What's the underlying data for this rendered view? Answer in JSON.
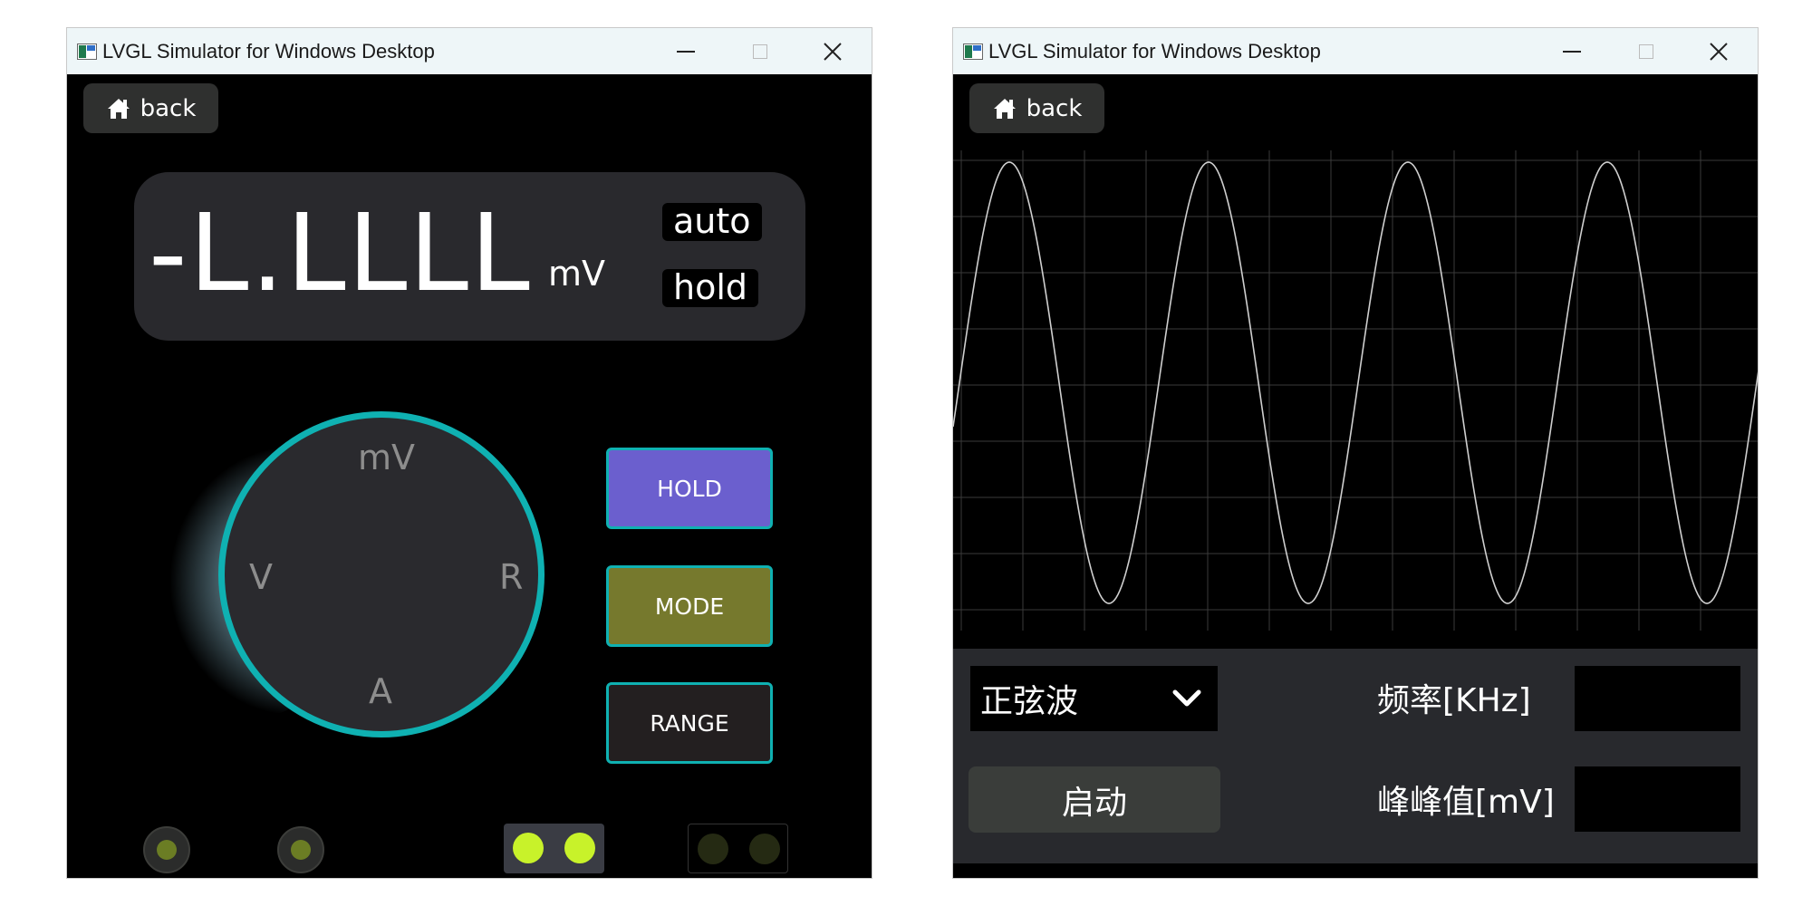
{
  "left_window": {
    "title": "LVGL Simulator for Windows Desktop",
    "back_label": "back",
    "display": {
      "reading": "-L.LLLL",
      "unit": "mV",
      "tag_auto": "auto",
      "tag_hold": "hold"
    },
    "dial": {
      "label_top": "mV",
      "label_left": "V",
      "label_right": "R",
      "label_bottom": "A"
    },
    "buttons": {
      "hold": "HOLD",
      "mode": "MODE",
      "range": "RANGE"
    },
    "colors": {
      "accent_teal": "#0fb1b2",
      "hold_button": "#6b5fce",
      "mode_button": "#76792d",
      "led_on": "#c8f22a"
    }
  },
  "right_window": {
    "title": "LVGL Simulator for Windows Desktop",
    "back_label": "back",
    "waveform": {
      "type": "sine",
      "cycles_visible": 4,
      "grid": true
    },
    "controls": {
      "wave_select_value": "正弦波",
      "start_label": "启动",
      "freq_label": "频率[KHz]",
      "freq_value": "",
      "vpp_label": "峰峰值[mV]",
      "vpp_value": ""
    }
  }
}
